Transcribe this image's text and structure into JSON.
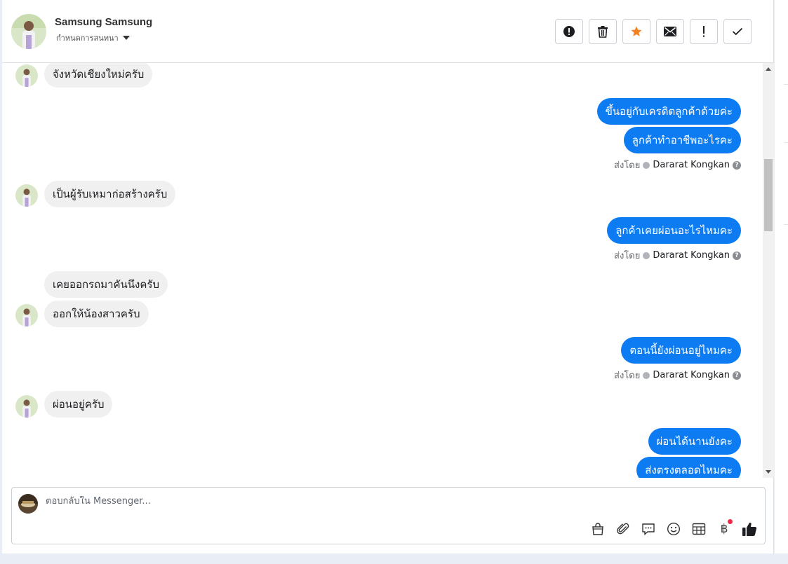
{
  "header": {
    "contact_name": "Samsung Samsung",
    "assign_label": "กำหนดการสนทนา",
    "actions": [
      {
        "name": "mark-spam-button",
        "icon": "alert-circle-icon"
      },
      {
        "name": "delete-button",
        "icon": "trash-icon"
      },
      {
        "name": "star-button",
        "icon": "star-icon"
      },
      {
        "name": "mark-unread-button",
        "icon": "envelope-icon"
      },
      {
        "name": "follow-up-button",
        "icon": "exclamation-icon"
      },
      {
        "name": "mark-done-button",
        "icon": "check-icon"
      }
    ]
  },
  "messages": {
    "m1": "จังหวัดเชียงใหม่ครับ",
    "m2": "ขึ้นอยู่กับเครดิตลูกค้าด้วยค่ะ",
    "m3": "ลูกค้าทำอาชีพอะไรคะ",
    "m4": "เป็นผู้รับเหมาก่อสร้างครับ",
    "m5": "ลูกค้าเคยผ่อนอะไรไหมคะ",
    "m6": "เคยออกรถมาคันนึงครับ",
    "m7": "ออกให้น้องสาวครับ",
    "m8": "ตอนนี้ยังผ่อนอยู่ไหมคะ",
    "m9": "ผ่อนอยู่ครับ",
    "m10": "ผ่อนได้นานยังคะ",
    "m11": "ส่งตรงตลอดไหมคะ"
  },
  "sent_by": {
    "prefix": "ส่งโดย",
    "agent": "Dararat Kongkan"
  },
  "composer": {
    "placeholder": "ตอบกลับใน Messenger..."
  },
  "colors": {
    "outgoing_bubble": "#0d7cf2",
    "incoming_bubble": "#f0f0f0",
    "star": "#f48120",
    "badge": "#f02849"
  }
}
